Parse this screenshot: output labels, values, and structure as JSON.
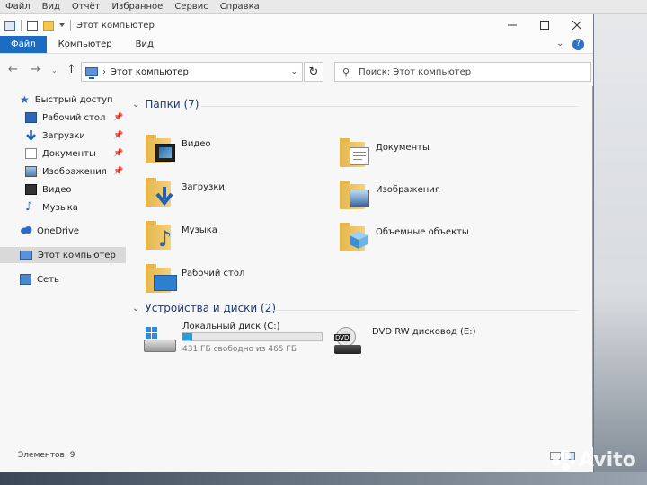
{
  "menubar": {
    "items": [
      "Файл",
      "Вид",
      "Отчёт",
      "Избранное",
      "Сервис",
      "Справка"
    ]
  },
  "window": {
    "title": "Этот компьютер",
    "ribbon_tabs": [
      "Файл",
      "Компьютер",
      "Вид"
    ],
    "help_chevron": "⌄",
    "help_icon": "?"
  },
  "address": {
    "location": "Этот компьютер",
    "chevron": "›"
  },
  "search": {
    "placeholder": "Поиск: Этот компьютер"
  },
  "sidebar": {
    "quick_access": "Быстрый доступ",
    "items": [
      "Рабочий стол",
      "Загрузки",
      "Документы",
      "Изображения",
      "Видео",
      "Музыка"
    ],
    "onedrive": "OneDrive",
    "this_pc": "Этот компьютер",
    "network": "Сеть"
  },
  "folders_group": {
    "header": "Папки (7)",
    "items": [
      "Видео",
      "Документы",
      "Загрузки",
      "Изображения",
      "Музыка",
      "Объемные объекты",
      "Рабочий стол"
    ]
  },
  "devices_group": {
    "header": "Устройства и диски (2)",
    "local_disk": {
      "name": "Локальный диск (C:)",
      "free_text": "431 ГБ свободно из 465 ГБ",
      "used_fraction": 0.073
    },
    "dvd": {
      "name": "DVD RW дисковод (E:)",
      "badge": "DVD"
    }
  },
  "status": {
    "items_count": "Элементов: 9"
  },
  "watermark": {
    "brand": "Avito"
  },
  "colors": {
    "accent": "#1c6dc2",
    "usage_fill": "#26a0da",
    "folder": "#e4b64c"
  }
}
